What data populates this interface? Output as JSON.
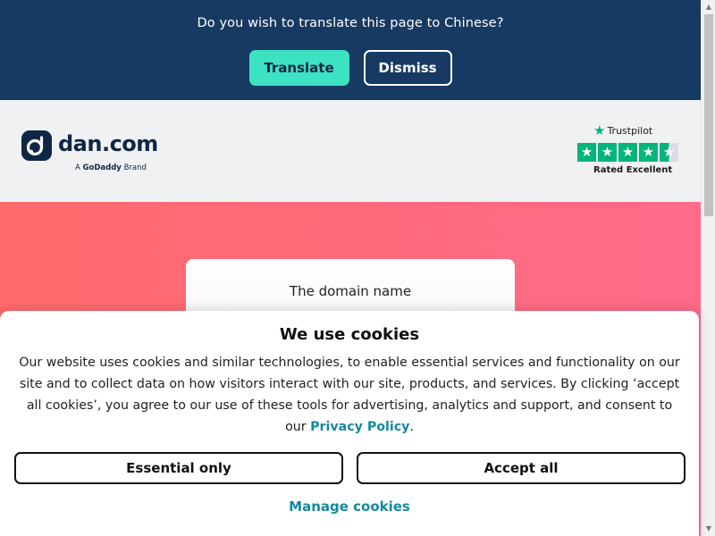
{
  "translate_bar": {
    "question": "Do you wish to translate this page to Chinese?",
    "translate_label": "Translate",
    "dismiss_label": "Dismiss"
  },
  "header": {
    "logo_text": "dan.com",
    "brand_prefix": "A",
    "brand_name": "GoDaddy",
    "brand_suffix": "Brand",
    "trustpilot": {
      "name": "Trustpilot",
      "rating_text": "Rated Excellent",
      "stars": 4.5
    }
  },
  "hero": {
    "domain_label": "The domain name"
  },
  "cookie_modal": {
    "title": "We use cookies",
    "body": "Our website uses cookies and similar technologies, to enable essential services and functionality on our site and to collect data on how visitors interact with our site, products, and services. By clicking ‘accept all cookies’, you agree to our use of these tools for advertising, analytics and support, and consent to our",
    "privacy_link": "Privacy Policy",
    "period": ".",
    "essential_label": "Essential only",
    "accept_label": "Accept all",
    "manage_label": "Manage cookies"
  },
  "colors": {
    "navy": "#173a63",
    "teal_button": "#3de2c3",
    "trustpilot_green": "#00b67a",
    "hero_start": "#ff6a6c",
    "hero_end": "#ff6b8a",
    "link": "#138a9e"
  },
  "icons": {
    "logo": "dan-logo-icon",
    "trustpilot_star": "trustpilot-star-icon"
  }
}
